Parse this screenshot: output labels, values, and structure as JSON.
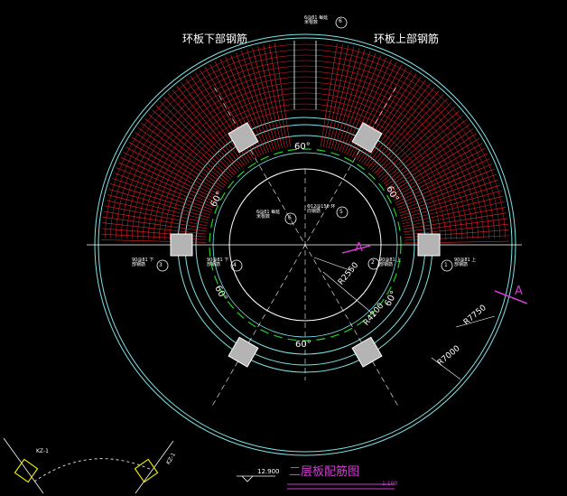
{
  "colors": {
    "background": "#000000",
    "outer_ring": "#7fe3e6",
    "rebar_red": "#e0262b",
    "ring_green": "#1ed21e",
    "white": "#ffffff",
    "magenta": "#d23cd2",
    "column_fill": "#b4b4b4"
  },
  "labels": {
    "top_left_title": "环板下部钢筋",
    "top_right_title": "环板上部钢筋",
    "top_note": "6@81 每延米根数",
    "top_circle_no": "6",
    "center_note_1": "Φ12@150 环向钢筋",
    "center_note_1_circle": "5",
    "center_note_2": "6@81 每延米根数",
    "center_note_2_circle": "6",
    "angle_top": "60°",
    "angle_upper_left": "60°",
    "angle_upper_right": "60°",
    "angle_lower_left": "60°",
    "angle_lower_right": "60°",
    "angle_bottom": "60°",
    "left_outer_note": "90@81 下部钢筋",
    "left_outer_circle": "3",
    "left_inner_note": "90@81 下部钢筋",
    "left_inner_circle": "4",
    "right_inner_note": "90@81 上部钢筋",
    "right_inner_circle": "2",
    "right_outer_note": "90@81 上部钢筋",
    "right_outer_circle": "1",
    "section_mark_right": "A",
    "section_mark_center": "A",
    "dim_r2550": "R2550",
    "dim_r4200": "R4200",
    "dim_r7750": "R7750",
    "dim_r7000": "R7000",
    "column_tag_left": "KZ-1",
    "column_tag_right": "KZ-1",
    "elevation": "12.900",
    "drawing_title": "二层板配筋图",
    "scale": "1:100"
  }
}
